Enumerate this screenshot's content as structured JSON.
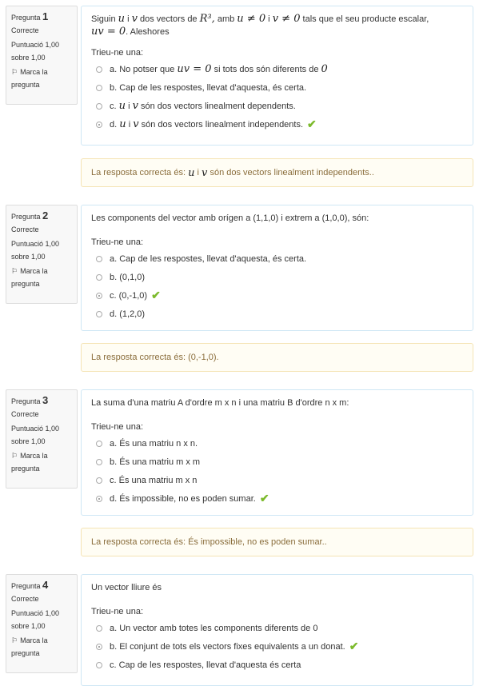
{
  "labels": {
    "question_word": "Pregunta",
    "state": "Correcte",
    "mark_line1": "Puntuació 1,00",
    "mark_line2": "sobre 1,00",
    "flag_line1": "Marca la",
    "flag_line2": "pregunta",
    "prompt": "Trieu-ne una:",
    "feedback_prefix": "La resposta correcta és:"
  },
  "questions": [
    {
      "number": "1",
      "text_parts": {
        "p1": "Siguin",
        "m1": "u",
        "p2": "i",
        "m2": "v",
        "p3": "dos vectors de",
        "m3": "R³,",
        "p4": "amb",
        "m4": "u ≠ 0",
        "p5": "i",
        "m5": "v ≠ 0",
        "p6": "tals que el seu producte escalar,",
        "m6": "uv = 0",
        "p7": ". Aleshores"
      },
      "options": {
        "a_pre": "a. No potser que",
        "a_m1": "uv = 0",
        "a_mid": "si tots dos són diferents de",
        "a_m2": "0",
        "b": "b. Cap de les respostes, llevat d'aquesta, és certa.",
        "c_pre": "c.",
        "c_m1": "u",
        "c_mid": "i",
        "c_m2": "v",
        "c_post": "són dos vectors linealment dependents.",
        "d_pre": "d.",
        "d_m1": "u",
        "d_mid": "i",
        "d_m2": "v",
        "d_post": "són dos vectors linealment independents."
      },
      "selected": "d",
      "feedback_parts": {
        "m1": "u",
        "mid": "i",
        "m2": "v",
        "post": "són dos vectors linealment independents.."
      }
    },
    {
      "number": "2",
      "text": "Les components del vector amb orígen a (1,1,0) i extrem a (1,0,0), són:",
      "options": [
        "a. Cap de les respostes, llevat d'aquesta, és certa.",
        "b. (0,1,0)",
        "c. (0,-1,0)",
        "d. (1,2,0)"
      ],
      "selected": "c",
      "feedback": "(0,-1,0)."
    },
    {
      "number": "3",
      "text": "La suma d'una matriu A d'ordre m x n i una matriu B d'ordre n x m:",
      "options": [
        "a. És una matriu n x n.",
        "b. És una matriu m x m",
        "c. És una matriu m x n",
        "d. És impossible, no es poden sumar."
      ],
      "selected": "d",
      "feedback": "És impossible, no es poden sumar.."
    },
    {
      "number": "4",
      "text": "Un vector lliure és",
      "options": [
        "a. Un vector amb totes les components diferents de 0",
        "b. El conjunt de tots els vectors fixes equivalents a un donat.",
        "c. Cap de les respostes, llevat d'aquesta és certa"
      ],
      "selected": "b"
    }
  ],
  "icons": {
    "flag": "flag-icon",
    "check": "checkmark-icon"
  },
  "colors": {
    "check": "#7cba2c",
    "feedback_text": "#8a6d3b",
    "feedback_bg": "#fffdf4",
    "content_border": "#cfe7f5"
  }
}
